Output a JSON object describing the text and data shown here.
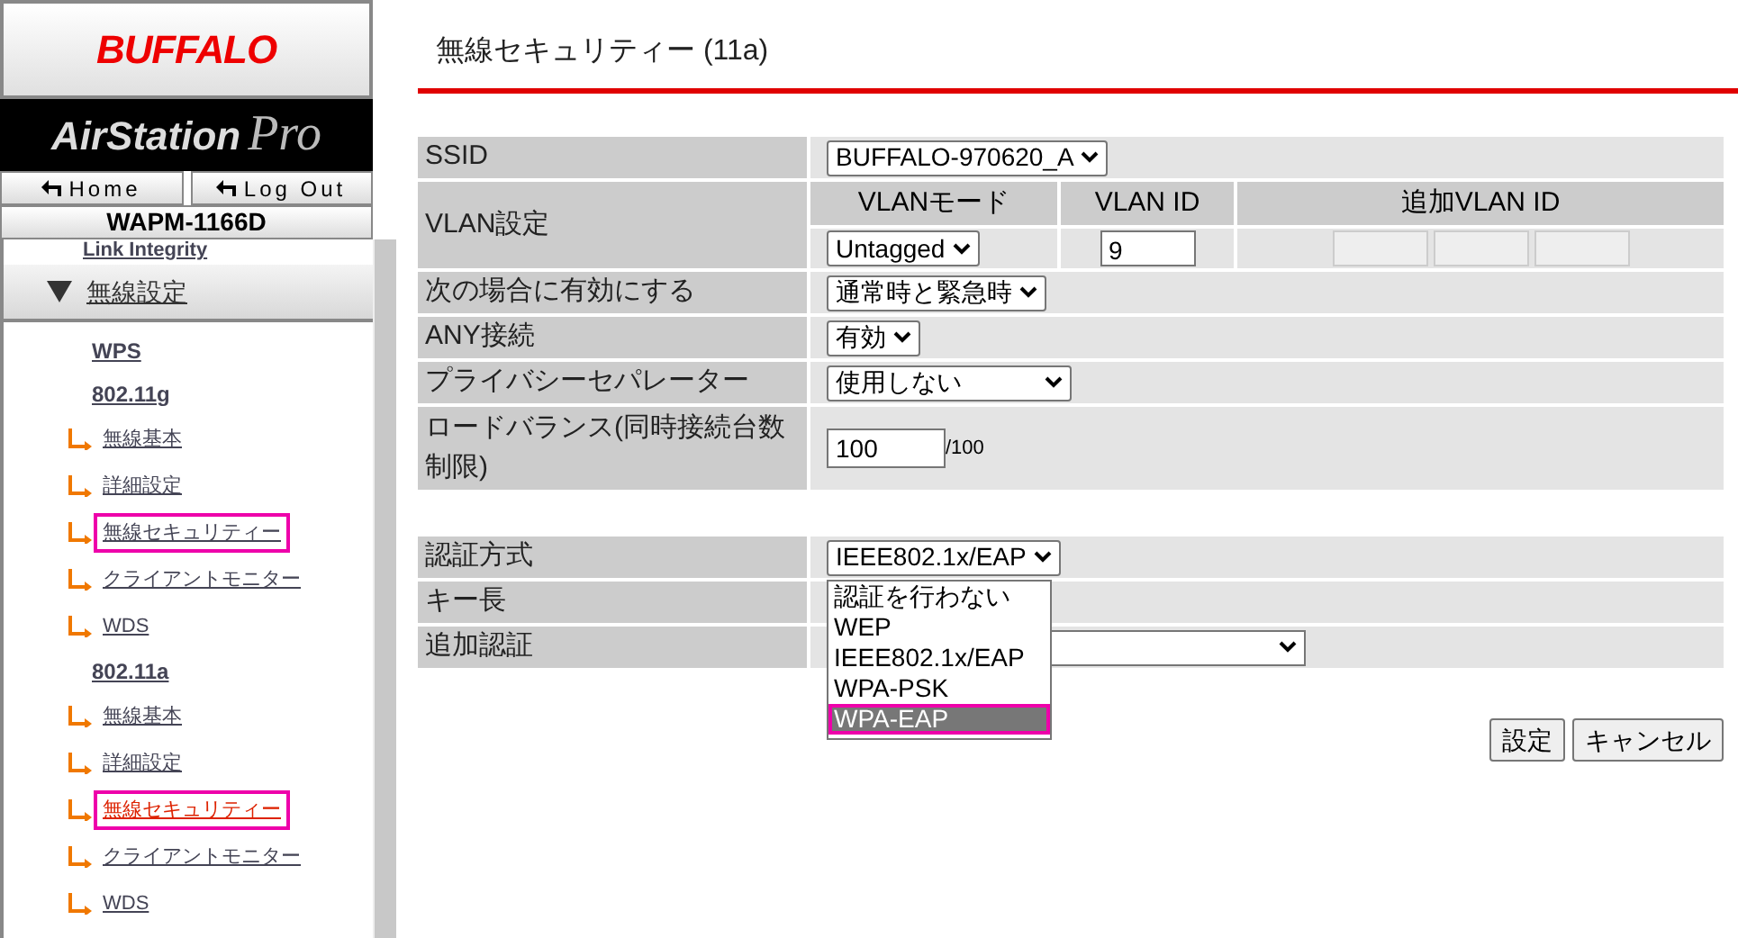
{
  "logo": {
    "brand": "BUFFALO",
    "product": "AirStation",
    "edition": "Pro"
  },
  "nav_buttons": [
    "Home",
    "Log Out"
  ],
  "model": "WAPM-1166D",
  "sidebar": {
    "partial_item": "Link Integrity",
    "section": {
      "label": "無線設定",
      "expanded": true
    },
    "items": [
      {
        "kind": "group",
        "label": "WPS",
        "highlighted": false,
        "current": false
      },
      {
        "kind": "group",
        "label": "802.11g",
        "highlighted": false,
        "current": false
      },
      {
        "kind": "sub",
        "label": "無線基本",
        "highlighted": false,
        "current": false
      },
      {
        "kind": "sub",
        "label": "詳細設定",
        "highlighted": false,
        "current": false
      },
      {
        "kind": "sub",
        "label": "無線セキュリティー",
        "highlighted": true,
        "current": false
      },
      {
        "kind": "sub",
        "label": "クライアントモニター",
        "highlighted": false,
        "current": false
      },
      {
        "kind": "sub",
        "label": "WDS",
        "highlighted": false,
        "current": false
      },
      {
        "kind": "group",
        "label": "802.11a",
        "highlighted": false,
        "current": false
      },
      {
        "kind": "sub",
        "label": "無線基本",
        "highlighted": false,
        "current": false
      },
      {
        "kind": "sub",
        "label": "詳細設定",
        "highlighted": false,
        "current": false
      },
      {
        "kind": "sub",
        "label": "無線セキュリティー",
        "highlighted": true,
        "current": true
      },
      {
        "kind": "sub",
        "label": "クライアントモニター",
        "highlighted": false,
        "current": false
      },
      {
        "kind": "sub",
        "label": "WDS",
        "highlighted": false,
        "current": false
      }
    ]
  },
  "page_title": "無線セキュリティー (11a)",
  "ssid": {
    "label": "SSID",
    "value": "BUFFALO-970620_A"
  },
  "vlan": {
    "label": "VLAN設定",
    "mode_header": "VLANモード",
    "id_header": "VLAN ID",
    "extra_header": "追加VLAN ID",
    "mode": "Untagged",
    "id": "9"
  },
  "enable_when": {
    "label": "次の場合に有効にする",
    "value": "通常時と緊急時"
  },
  "any": {
    "label": "ANY接続",
    "value": "有効"
  },
  "privacy": {
    "label": "プライバシーセパレーター",
    "value": "使用しない"
  },
  "load_balance": {
    "label": "ロードバランス(同時接続台数制限)",
    "value": "100",
    "max": "/100"
  },
  "auth": {
    "label": "認証方式",
    "value": "IEEE802.1x/EAP",
    "options": [
      {
        "label": "認証を行わない",
        "highlighted": false
      },
      {
        "label": "WEP",
        "highlighted": false
      },
      {
        "label": "IEEE802.1x/EAP",
        "highlighted": false
      },
      {
        "label": "WPA-PSK",
        "highlighted": false
      },
      {
        "label": "WPA-EAP",
        "highlighted": true
      }
    ]
  },
  "key_length": {
    "label": "キー長"
  },
  "extra_auth": {
    "label": "追加認証"
  },
  "buttons": [
    "設定",
    "キャンセル"
  ]
}
